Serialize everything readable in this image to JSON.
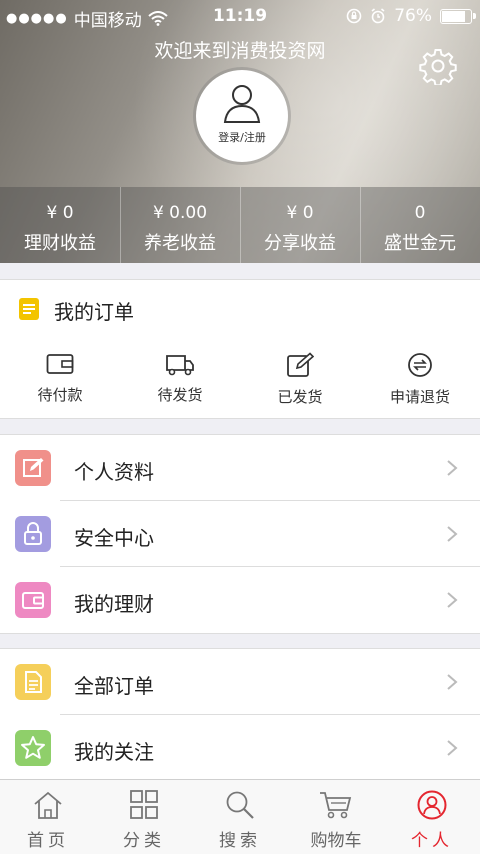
{
  "status_bar": {
    "carrier": "中国移动",
    "time": "11:19",
    "battery": "76%",
    "battery_level": 0.76
  },
  "header": {
    "welcome": "欢迎来到消费投资网",
    "login_label": "登录/注册",
    "stats": [
      {
        "value": "¥ 0",
        "label": "理财收益"
      },
      {
        "value": "¥ 0.00",
        "label": "养老收益"
      },
      {
        "value": "¥ 0",
        "label": "分享收益"
      },
      {
        "value": "0",
        "label": "盛世金元"
      }
    ]
  },
  "orders": {
    "title": "我的订单",
    "items": [
      {
        "label": "待付款",
        "icon": "wallet-icon"
      },
      {
        "label": "待发货",
        "icon": "truck-icon"
      },
      {
        "label": "已发货",
        "icon": "edit-icon"
      },
      {
        "label": "申请退货",
        "icon": "return-icon"
      }
    ]
  },
  "menu_groups": [
    [
      {
        "label": "个人资料",
        "icon": "profile-edit-icon",
        "color": "#f0908a"
      },
      {
        "label": "安全中心",
        "icon": "lock-icon",
        "color": "#a39ce0"
      },
      {
        "label": "我的理财",
        "icon": "wallet-finance-icon",
        "color": "#ee89c2"
      }
    ],
    [
      {
        "label": "全部订单",
        "icon": "document-icon",
        "color": "#f5cf5a"
      },
      {
        "label": "我的关注",
        "icon": "star-icon",
        "color": "#8fcf6a"
      }
    ]
  ],
  "tabbar": [
    {
      "label": "首页",
      "icon": "home-icon",
      "active": false
    },
    {
      "label": "分类",
      "icon": "grid-icon",
      "active": false
    },
    {
      "label": "搜索",
      "icon": "search-icon",
      "active": false
    },
    {
      "label": "购物车",
      "icon": "cart-icon",
      "active": false
    },
    {
      "label": "个人",
      "icon": "user-icon",
      "active": true
    }
  ],
  "colors": {
    "accent": "#e4262f",
    "order_icon_yellow": "#f3c400"
  }
}
